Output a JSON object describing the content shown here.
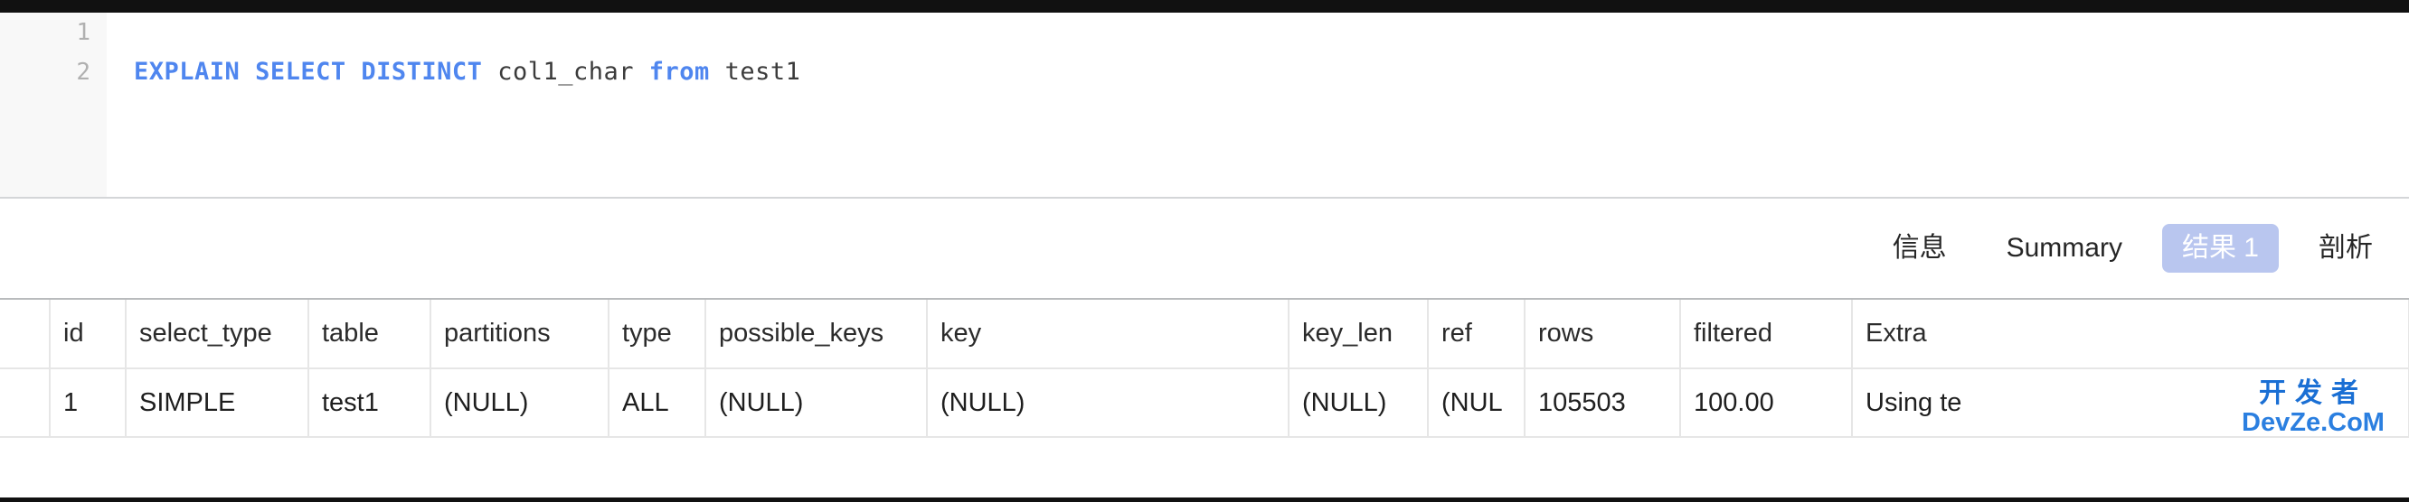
{
  "editor": {
    "line_numbers": [
      "1",
      "2"
    ],
    "lines": [
      {
        "tokens": []
      },
      {
        "tokens": [
          {
            "text": "EXPLAIN",
            "type": "keyword"
          },
          {
            "text": " ",
            "type": "plain"
          },
          {
            "text": "SELECT",
            "type": "keyword"
          },
          {
            "text": " ",
            "type": "plain"
          },
          {
            "text": "DISTINCT",
            "type": "keyword"
          },
          {
            "text": " ",
            "type": "plain"
          },
          {
            "text": "col1_char",
            "type": "identifier"
          },
          {
            "text": " ",
            "type": "plain"
          },
          {
            "text": "from",
            "type": "keyword"
          },
          {
            "text": " ",
            "type": "plain"
          },
          {
            "text": "test1",
            "type": "identifier"
          }
        ]
      }
    ],
    "full_sql": "EXPLAIN SELECT DISTINCT col1_char from test1"
  },
  "tabs": [
    {
      "label": "信息",
      "active": false
    },
    {
      "label": "Summary",
      "active": false
    },
    {
      "label": "结果 1",
      "active": true
    },
    {
      "label": "剖析",
      "active": false
    }
  ],
  "result_table": {
    "columns": [
      "id",
      "select_type",
      "table",
      "partitions",
      "type",
      "possible_keys",
      "key",
      "key_len",
      "ref",
      "rows",
      "filtered",
      "Extra"
    ],
    "rows": [
      {
        "id": "1",
        "select_type": "SIMPLE",
        "table": "test1",
        "partitions": "(NULL)",
        "type": "ALL",
        "possible_keys": "(NULL)",
        "key": "(NULL)",
        "key_len": "(NULL)",
        "ref": "(NUL",
        "rows": "105503",
        "filtered": "100.00",
        "Extra": "Using te"
      }
    ]
  },
  "watermark": {
    "line1": "开发者",
    "line2": "DevZe.CoM"
  },
  "colors": {
    "keyword": "#4f86ef",
    "active_tab_bg": "#b9c6ef",
    "null_text": "#b2b2b2",
    "watermark": "#2b7fe0"
  }
}
